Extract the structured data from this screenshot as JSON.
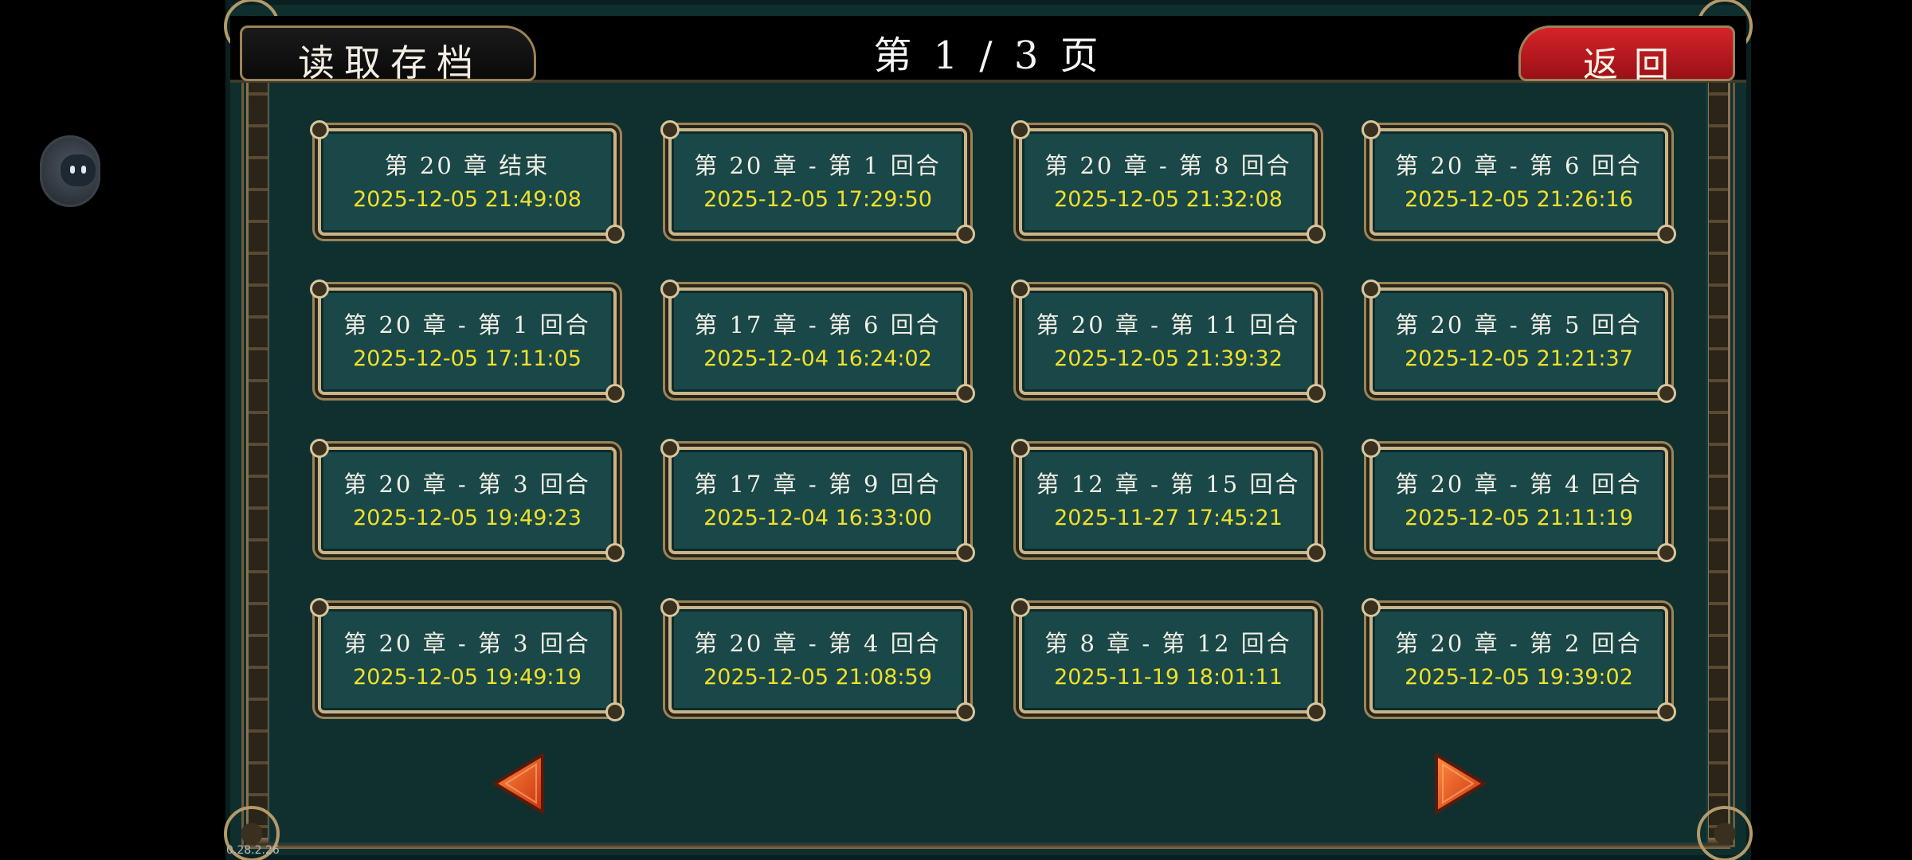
{
  "header": {
    "title": "读取存档",
    "page_indicator": "第 1 / 3 页",
    "back_label": "返回"
  },
  "slots": [
    {
      "title": "第 20 章 结束",
      "time": "2025-12-05 21:49:08"
    },
    {
      "title": "第 20 章 - 第 1 回合",
      "time": "2025-12-05 17:29:50"
    },
    {
      "title": "第 20 章 - 第 8 回合",
      "time": "2025-12-05 21:32:08"
    },
    {
      "title": "第 20 章 - 第 6 回合",
      "time": "2025-12-05 21:26:16"
    },
    {
      "title": "第 20 章 - 第 1 回合",
      "time": "2025-12-05 17:11:05"
    },
    {
      "title": "第 17 章 - 第 6 回合",
      "time": "2025-12-04 16:24:02"
    },
    {
      "title": "第 20 章 - 第 11 回合",
      "time": "2025-12-05 21:39:32"
    },
    {
      "title": "第 20 章 - 第 5 回合",
      "time": "2025-12-05 21:21:37"
    },
    {
      "title": "第 20 章 - 第 3 回合",
      "time": "2025-12-05 19:49:23"
    },
    {
      "title": "第 17 章 - 第 9 回合",
      "time": "2025-12-04 16:33:00"
    },
    {
      "title": "第 12 章 - 第 15 回合",
      "time": "2025-11-27 17:45:21"
    },
    {
      "title": "第 20 章 - 第 4 回合",
      "time": "2025-12-05 21:11:19"
    },
    {
      "title": "第 20 章 - 第 3 回合",
      "time": "2025-12-05 19:49:19"
    },
    {
      "title": "第 20 章 - 第 4 回合",
      "time": "2025-12-05 21:08:59"
    },
    {
      "title": "第 8 章 - 第 12 回合",
      "time": "2025-11-19 18:01:11"
    },
    {
      "title": "第 20 章 - 第 2 回合",
      "time": "2025-12-05 19:39:02"
    }
  ],
  "navigation": {
    "prev_icon": "triangle-left-icon",
    "next_icon": "triangle-right-icon"
  },
  "colors": {
    "panel_bg": "#0f2e2e",
    "slot_bg": "#1a4747",
    "slot_time": "#f0e02a",
    "back_button": "#d6232a",
    "arrow": "#e5531f",
    "frame_gold": "#c9b58a"
  },
  "overlay": {
    "assistant_icon": "robot-face-icon"
  },
  "footer": {
    "version": "0.28.2.26"
  }
}
